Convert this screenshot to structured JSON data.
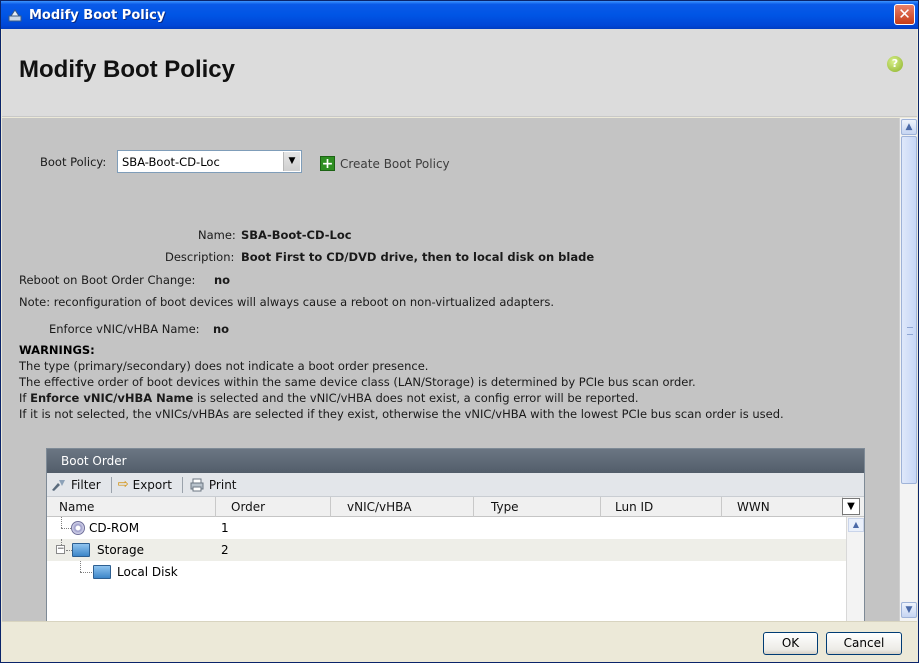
{
  "window": {
    "title": "Modify Boot Policy",
    "close_glyph": "✕"
  },
  "header": {
    "title": "Modify Boot Policy",
    "help_glyph": "?"
  },
  "policy_select": {
    "label": "Boot Policy:",
    "value": "SBA-Boot-CD-Loc"
  },
  "create_link": "Create Boot Policy",
  "details": {
    "name_label": "Name:",
    "name_value": "SBA-Boot-CD-Loc",
    "description_label": "Description:",
    "description_value": "Boot First to CD/DVD drive, then to local disk on blade",
    "reboot_label": "Reboot on Boot Order Change:",
    "reboot_value": "no",
    "note": "Note: reconfiguration of boot devices will always cause a reboot on non-virtualized adapters.",
    "enforce_label": "Enforce vNIC/vHBA Name:",
    "enforce_value": "no"
  },
  "warnings": {
    "title": "WARNINGS:",
    "line1": "The type (primary/secondary) does not indicate a boot order presence.",
    "line2": "The effective order of boot devices within the same device class (LAN/Storage) is determined by PCIe bus scan order.",
    "line3_prefix": "If ",
    "line3_bold": "Enforce vNIC/vHBA Name",
    "line3_suffix": " is selected and the vNIC/vHBA does not exist, a config error will be reported.",
    "line4": "If it is not selected, the vNICs/vHBAs are selected if they exist, otherwise the vNIC/vHBA with the lowest PCIe bus scan order is used."
  },
  "boot_order": {
    "panel_title": "Boot Order",
    "toolbar": {
      "filter": "Filter",
      "export": "Export",
      "print": "Print"
    },
    "columns": [
      "Name",
      "Order",
      "vNIC/vHBA",
      "Type",
      "Lun ID",
      "WWN"
    ],
    "rows": [
      {
        "name": "CD-ROM",
        "order": "1",
        "icon": "cd-rom-icon"
      },
      {
        "name": "Storage",
        "order": "2",
        "icon": "storage-icon",
        "expanded": true
      },
      {
        "name": "Local Disk",
        "order": "",
        "icon": "local-disk-icon"
      }
    ]
  },
  "footer": {
    "ok": "OK",
    "cancel": "Cancel"
  },
  "colors": {
    "titlebar": "#0055e5",
    "content_bg": "#c4c4c4",
    "panel_header": "#5f6a77"
  }
}
